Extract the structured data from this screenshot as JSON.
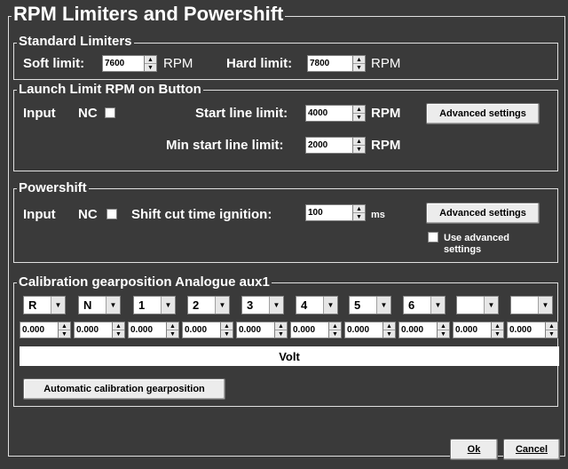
{
  "dialog": {
    "title": "RPM Limiters and Powershift"
  },
  "standard": {
    "title": "Standard Limiters",
    "soft_label": "Soft limit:",
    "soft_value": "7600",
    "soft_unit": "RPM",
    "hard_label": "Hard limit:",
    "hard_value": "7800",
    "hard_unit": "RPM"
  },
  "launch": {
    "title": "Launch Limit RPM on Button",
    "input_label": "Input",
    "nc_label": "NC",
    "start_label": "Start line limit:",
    "start_value": "4000",
    "start_unit": "RPM",
    "min_label": "Min start line limit:",
    "min_value": "2000",
    "min_unit": "RPM",
    "advanced_label": "Advanced settings"
  },
  "powershift": {
    "title": "Powershift",
    "input_label": "Input",
    "nc_label": "NC",
    "cut_label": "Shift cut time ignition:",
    "cut_value": "100",
    "cut_unit": "ms",
    "advanced_label": "Advanced settings",
    "use_advanced_line1": "Use advanced",
    "use_advanced_line2": "settings"
  },
  "calibration": {
    "title": "Calibration gearposition Analogue aux1",
    "gears": [
      "R",
      "N",
      "1",
      "2",
      "3",
      "4",
      "5",
      "6",
      "",
      ""
    ],
    "values": [
      "0.000",
      "0.000",
      "0.000",
      "0.000",
      "0.000",
      "0.000",
      "0.000",
      "0.000",
      "0.000",
      "0.000"
    ],
    "unit_label": "Volt",
    "auto_button": "Automatic calibration gearposition"
  },
  "footer": {
    "ok_label": "Ok",
    "cancel_label": "Cancel"
  }
}
